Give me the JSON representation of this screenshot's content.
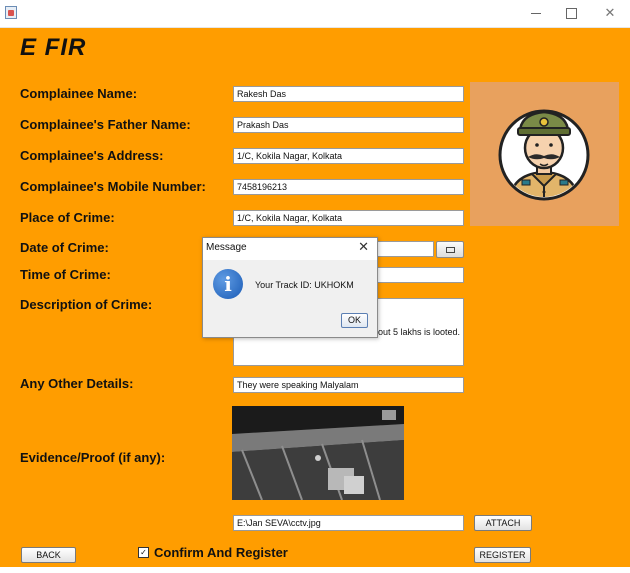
{
  "window": {
    "title": ""
  },
  "app": {
    "brand": "E FIR"
  },
  "form": {
    "fields": [
      {
        "label": "Complainee Name:",
        "value": "Rakesh Das"
      },
      {
        "label": "Complainee's Father Name:",
        "value": "Prakash Das"
      },
      {
        "label": "Complainee's Address:",
        "value": "1/C, Kokila Nagar, Kolkata"
      },
      {
        "label": "Complainee's Mobile Number:",
        "value": "7458196213"
      },
      {
        "label": "Place of Crime:",
        "value": "1/C, Kokila Nagar, Kolkata"
      },
      {
        "label": "Date of Crime:",
        "value": ""
      },
      {
        "label": "Time of Crime:",
        "value": ""
      },
      {
        "label": "Description of Crime:",
        "value": "about 5 lakhs is looted."
      },
      {
        "label": "Any Other Details:",
        "value": "They were speaking Malyalam"
      },
      {
        "label": "Evidence/Proof (if any):",
        "value": "E:\\Jan SEVA\\cctv.jpg"
      }
    ],
    "attach_label": "ATTACH",
    "back_label": "BACK",
    "confirm_label": "Confirm And Register",
    "confirm_checked": true,
    "register_label": "REGISTER"
  },
  "dialog": {
    "title": "Message",
    "message": "Your Track ID: UKHOKM",
    "ok_label": "OK"
  },
  "icons": {
    "app": "java-cup-icon",
    "minimize": "minimize-icon",
    "maximize": "maximize-icon",
    "close": "close-icon",
    "calendar": "calendar-icon",
    "info": "info-icon",
    "checkbox": "check-icon",
    "avatar": "police-officer-icon"
  },
  "colors": {
    "panel": "#ff9d00",
    "avatar_bg": "#e8a15e",
    "info": "#1a5bb5"
  }
}
